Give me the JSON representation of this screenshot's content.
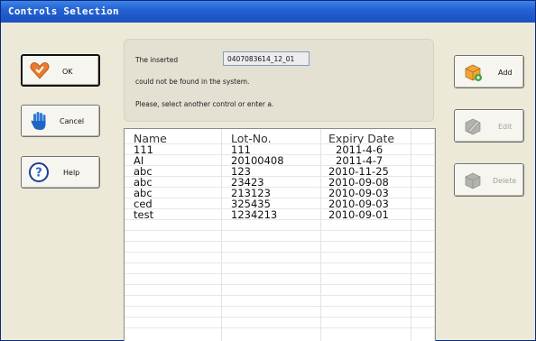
{
  "window": {
    "title": "Controls Selection"
  },
  "left_buttons": {
    "ok": "OK",
    "cancel": "Cancel",
    "help": "Help"
  },
  "right_buttons": {
    "add": "Add",
    "edit": "Edit",
    "delete": "Delete"
  },
  "message": {
    "line1": "The inserted",
    "lot_value": "0407083614_12_01",
    "line2": "could not be found in the system.",
    "line3": "Please, select another control or enter a."
  },
  "table": {
    "headers": [
      "Name",
      "Lot-No.",
      "Expiry Date"
    ],
    "rows": [
      [
        "111",
        "111",
        "2011-4-6"
      ],
      [
        "AI",
        "20100408",
        "2011-4-7"
      ],
      [
        "abc",
        "123",
        "2010-11-25"
      ],
      [
        "abc",
        "23423",
        "2010-09-08"
      ],
      [
        "abc",
        "213123",
        "2010-09-03"
      ],
      [
        "ced",
        "325435",
        "2010-09-03"
      ],
      [
        "test",
        "1234213",
        "2010-09-01"
      ]
    ]
  },
  "icons": {
    "ok": "heart-check-icon",
    "cancel": "hand-stop-icon",
    "help": "question-circle-icon",
    "add": "box-add-icon",
    "edit": "box-edit-icon",
    "delete": "box-delete-icon"
  },
  "colors": {
    "titlebar": "#2462d3",
    "window_bg": "#ece9d8",
    "disabled_text": "#a5a394"
  }
}
